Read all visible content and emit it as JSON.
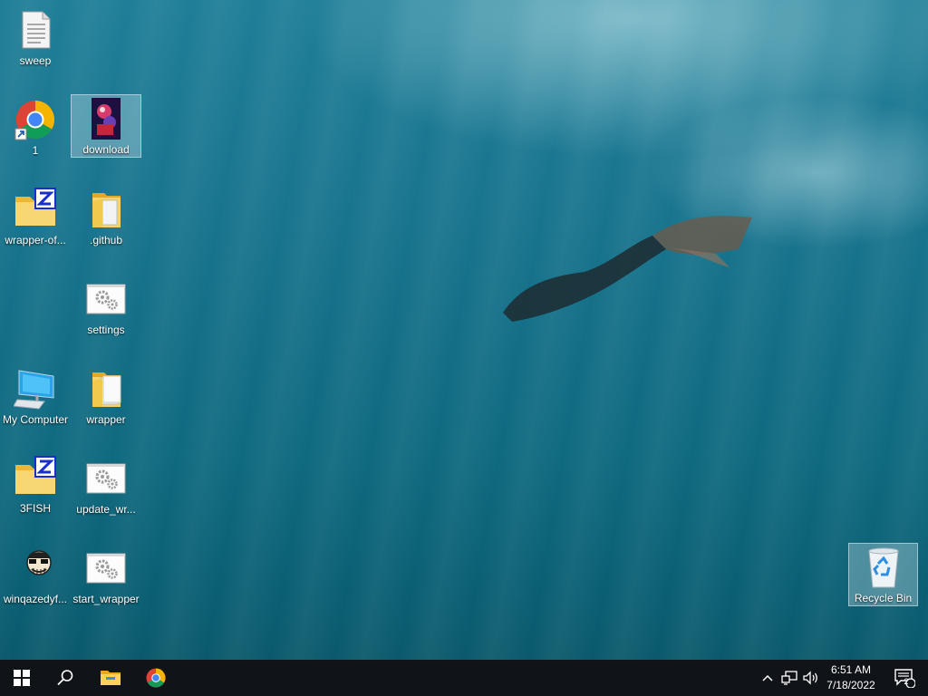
{
  "desktop": {
    "icons": [
      {
        "label": "sweep",
        "icon": "text-file-icon"
      },
      {
        "label": "1",
        "icon": "chrome-shortcut-icon"
      },
      {
        "label": "download",
        "icon": "image-file-icon"
      },
      {
        "label": "wrapper-of...",
        "icon": "zip-folder-icon"
      },
      {
        "label": ".github",
        "icon": "folder-icon"
      },
      {
        "label": "settings",
        "icon": "config-file-icon"
      },
      {
        "label": "My Computer",
        "icon": "computer-icon"
      },
      {
        "label": "wrapper",
        "icon": "folder-icon"
      },
      {
        "label": "3FISH",
        "icon": "zip-folder-icon"
      },
      {
        "label": "update_wr...",
        "icon": "config-file-icon"
      },
      {
        "label": "winqazedyf...",
        "icon": "face-app-icon"
      },
      {
        "label": "start_wrapper",
        "icon": "config-file-icon"
      },
      {
        "label": "Recycle Bin",
        "icon": "recycle-bin-icon"
      }
    ]
  },
  "taskbar": {
    "start": "windows-start-icon",
    "search": "search-icon",
    "pinned": [
      "file-explorer-icon",
      "chrome-icon"
    ],
    "tray": [
      "chevron-up-icon",
      "network-icon",
      "volume-icon"
    ],
    "clock": {
      "time": "6:51 AM",
      "date": "7/18/2022"
    },
    "notifications": {
      "count": "2"
    }
  },
  "colors": {
    "taskbar": "#101418",
    "selection": "#c8e1eb",
    "water": "#147088"
  }
}
